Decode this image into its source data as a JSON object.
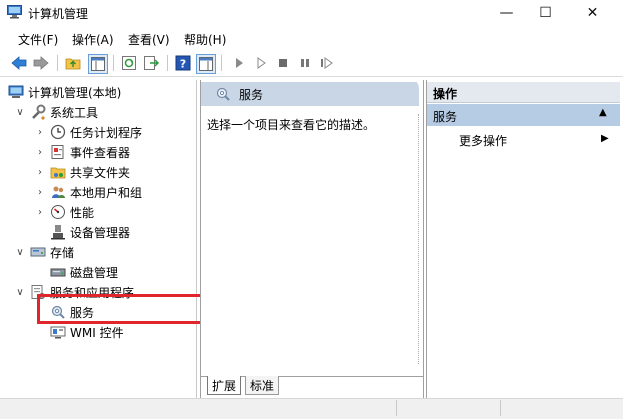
{
  "window": {
    "title": "计算机管理",
    "minimize": "—",
    "maximize": "☐",
    "close": "✕"
  },
  "menu": [
    "文件(F)",
    "操作(A)",
    "查看(V)",
    "帮助(H)"
  ],
  "tree": {
    "root": "计算机管理(本地)",
    "system_tools": "系统工具",
    "task_scheduler": "任务计划程序",
    "event_viewer": "事件查看器",
    "shared_folders": "共享文件夹",
    "local_users": "本地用户和组",
    "performance": "性能",
    "device_manager": "设备管理器",
    "storage": "存储",
    "disk_management": "磁盘管理",
    "services_apps": "服务和应用程序",
    "services": "服务",
    "wmi": "WMI 控件"
  },
  "center": {
    "header": "服务",
    "description": "选择一个项目来查看它的描述。",
    "tab_extended": "扩展",
    "tab_standard": "标准"
  },
  "actions": {
    "header": "操作",
    "section": "服务",
    "more": "更多操作"
  },
  "colors": {
    "highlight_border": "#e0262b",
    "pane_header": "#c9d6e6",
    "selected_section": "#b6cbe4"
  }
}
